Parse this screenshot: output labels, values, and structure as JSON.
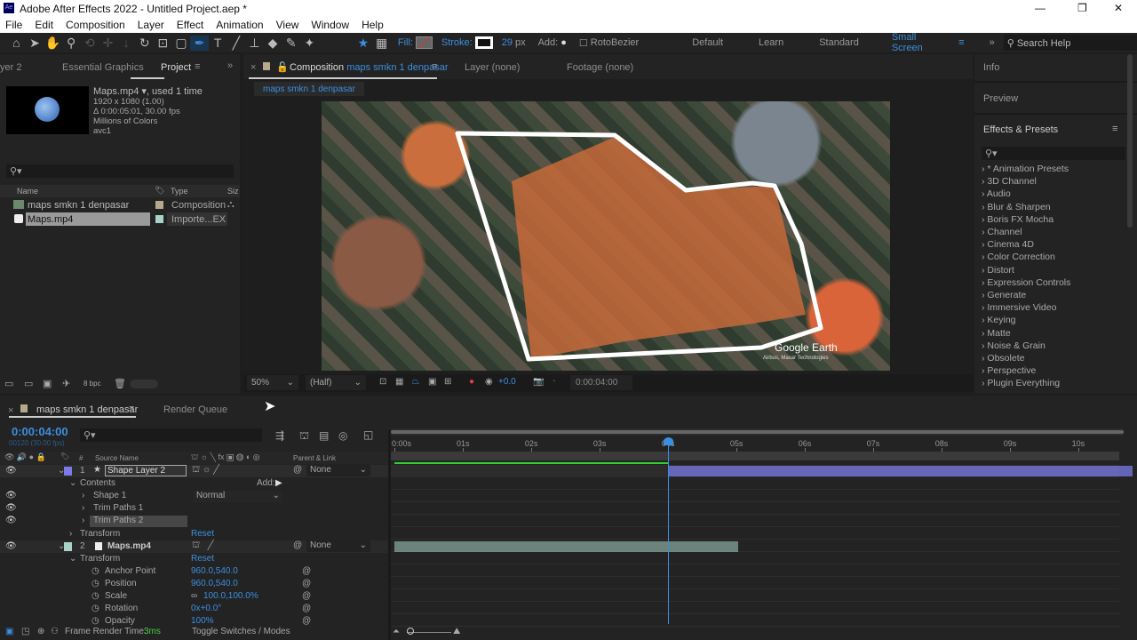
{
  "window": {
    "title": "Adobe After Effects 2022 - Untitled Project.aep *",
    "controls": [
      "—",
      "❐",
      "✕"
    ]
  },
  "menu": [
    "File",
    "Edit",
    "Composition",
    "Layer",
    "Effect",
    "Animation",
    "View",
    "Window",
    "Help"
  ],
  "toolbar": {
    "fill_label": "Fill:",
    "stroke_label": "Stroke:",
    "stroke_width": "29",
    "stroke_unit": "px",
    "add_label": "Add:",
    "rotobezier": "RotoBezier",
    "workspaces": [
      "Default",
      "Learn",
      "Standard",
      "Small Screen"
    ],
    "search_placeholder": "Search Help"
  },
  "project": {
    "tabs": [
      "yer 2",
      "Essential Graphics",
      "Project"
    ],
    "item_name": "Maps.mp4",
    "item_used": ", used 1 time",
    "info": [
      "1920 x 1080 (1.00)",
      "Δ 0:00:05:01, 30.00 fps",
      "Millions of Colors",
      "avc1"
    ],
    "columns": [
      "Name",
      "Type",
      "Siz"
    ],
    "items": [
      {
        "name": "maps smkn 1 denpasar",
        "type": "Composition",
        "color": "#b5a98a"
      },
      {
        "name": "Maps.mp4",
        "type": "Importe...EX",
        "color": "#a9d3c8"
      }
    ],
    "bpc": "8 bpc"
  },
  "comp": {
    "tab_prefix": "Composition",
    "tab_name": "maps smkn 1 denpasar",
    "layer_tab": "Layer  (none)",
    "footage_tab": "Footage  (none)",
    "breadcrumb": "maps smkn 1 denpasar",
    "watermark": "Google Earth",
    "watermark_sub": "Airbus, Maxar Technologies",
    "zoom": "50%",
    "resolution": "(Half)",
    "exposure": "+0.0",
    "timecode": "0:00:04:00"
  },
  "right": {
    "info": "Info",
    "preview": "Preview",
    "effects_title": "Effects & Presets",
    "effects": [
      "* Animation Presets",
      "3D Channel",
      "Audio",
      "Blur & Sharpen",
      "Boris FX Mocha",
      "Channel",
      "Cinema 4D",
      "Color Correction",
      "Distort",
      "Expression Controls",
      "Generate",
      "Immersive Video",
      "Keying",
      "Matte",
      "Noise & Grain",
      "Obsolete",
      "Perspective",
      "Plugin Everything"
    ]
  },
  "timeline": {
    "tab": "maps smkn 1 denpasar",
    "render_queue": "Render Queue",
    "timecode": "0:00:04:00",
    "frames": "00120 (30.00 fps)",
    "col_source": "Source Name",
    "col_parent": "Parent & Link",
    "ticks": [
      "0:00s",
      "01s",
      "02s",
      "03s",
      "04s",
      "05s",
      "06s",
      "07s",
      "08s",
      "09s",
      "10s"
    ],
    "playhead_seconds": 4,
    "duration_seconds": 10.8,
    "layers": [
      {
        "num": "1",
        "name": "Shape Layer 2",
        "parent": "None",
        "color": "#7b7bea",
        "bar_start": 4,
        "bar_end": 10.8
      },
      {
        "num": "2",
        "name": "Maps.mp4",
        "parent": "None",
        "color": "#a9d3c8",
        "bar_start": 0,
        "bar_end": 5.03
      }
    ],
    "contents": "Contents",
    "add": "Add:",
    "shape1": "Shape 1",
    "blend": "Normal",
    "trim1": "Trim Paths 1",
    "trim2": "Trim Paths 2",
    "transform": "Transform",
    "reset": "Reset",
    "props": [
      {
        "name": "Anchor Point",
        "value": "960.0,540.0"
      },
      {
        "name": "Position",
        "value": "960.0,540.0"
      },
      {
        "name": "Scale",
        "value": "100.0,100.0%"
      },
      {
        "name": "Rotation",
        "value": "0x+0.0°"
      },
      {
        "name": "Opacity",
        "value": "100%"
      }
    ],
    "render_time_label": "Frame Render Time:",
    "render_time": "3ms",
    "toggle": "Toggle Switches / Modes"
  }
}
